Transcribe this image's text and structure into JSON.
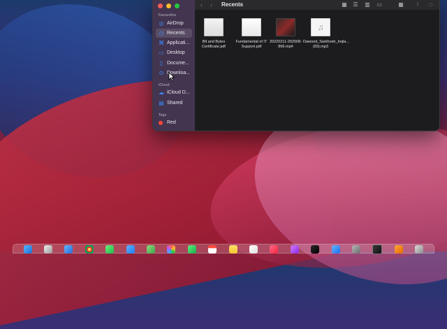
{
  "window": {
    "title": "Recents",
    "nav_back": "‹",
    "nav_forward": "›"
  },
  "sidebar": {
    "favourites_header": "Favourites",
    "items": [
      {
        "label": "AirDrop",
        "icon": "airdrop-icon"
      },
      {
        "label": "Recents",
        "icon": "clock-icon"
      },
      {
        "label": "Applicati...",
        "icon": "applications-icon"
      },
      {
        "label": "Desktop",
        "icon": "desktop-icon"
      },
      {
        "label": "Docume...",
        "icon": "document-icon"
      },
      {
        "label": "Downloa...",
        "icon": "download-icon"
      }
    ],
    "icloud_header": "iCloud",
    "icloud_items": [
      {
        "label": "iCloud D...",
        "icon": "cloud-icon"
      },
      {
        "label": "Shared",
        "icon": "shared-folder-icon"
      }
    ],
    "tags_header": "Tags",
    "tags": [
      {
        "label": "Red",
        "color": "#ff453a"
      }
    ]
  },
  "files": [
    {
      "name": "Bit and Bytes Certificate.pdf",
      "icon": "pdf-icon"
    },
    {
      "name": "Fundamental of IT Support.pdf",
      "icon": "pdf-icon"
    },
    {
      "name": "20220211-202008-866.mp4",
      "icon": "video-icon"
    },
    {
      "name": "Dawood_Sarkhosh_Inqla...(83).mp3",
      "icon": "audio-icon"
    }
  ],
  "colors": {
    "accent": "#3a8cff",
    "close": "#ff5f57",
    "minimize": "#febc2e",
    "zoom": "#28c840"
  },
  "dock_apps": [
    "finder",
    "launchpad",
    "safari",
    "chrome",
    "messages",
    "mail",
    "maps",
    "photos",
    "facetime",
    "calendar",
    "notes",
    "reminders",
    "music",
    "podcasts",
    "tv",
    "appstore",
    "preferences",
    "terminal",
    "vlc",
    "trash"
  ]
}
